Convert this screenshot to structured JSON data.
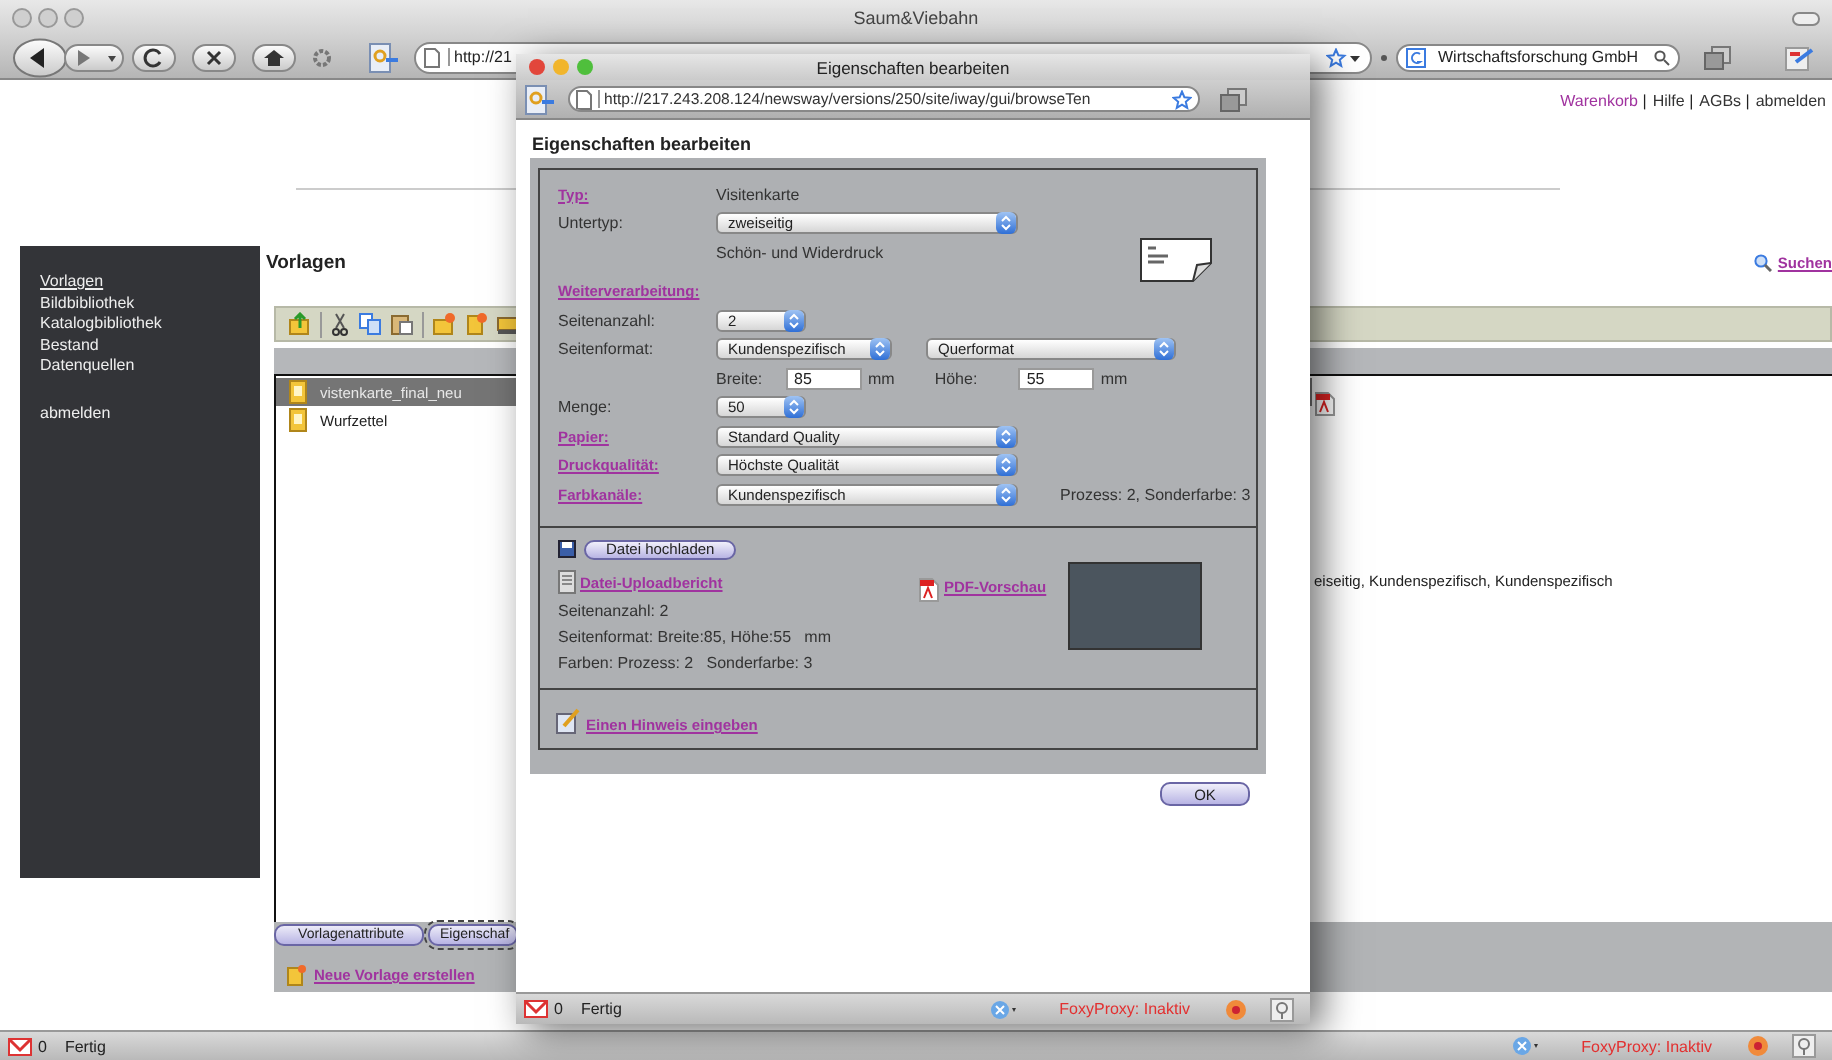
{
  "browser": {
    "title": "Saum&Viebahn",
    "url": "http://21",
    "search": "Wirtschaftsforschung GmbH"
  },
  "header_links": {
    "separator": "|",
    "items": [
      {
        "label": "Warenkorb",
        "visited": true
      },
      {
        "label": "Hilfe",
        "visited": false
      },
      {
        "label": "AGBs",
        "visited": false
      },
      {
        "label": "abmelden",
        "visited": false
      }
    ]
  },
  "sidebar": {
    "items": [
      {
        "label": "Vorlagen",
        "selected": true
      },
      {
        "label": "Bildbibliothek",
        "selected": false
      },
      {
        "label": "Katalogbibliothek",
        "selected": false
      },
      {
        "label": "Bestand",
        "selected": false
      },
      {
        "label": "Datenquellen",
        "selected": false
      }
    ],
    "logout": "abmelden"
  },
  "page": {
    "title": "Vorlagen",
    "search_link": "Suchen"
  },
  "templates": {
    "rows": [
      {
        "name": "vistenkarte_final_neu",
        "selected": true
      },
      {
        "name": "Wurfzettel",
        "selected": false
      }
    ],
    "detail_text": "eiseitig, Kundenspezifisch, Kundenspezifisch"
  },
  "tabs": [
    {
      "label": "Vorlagenattribute",
      "selected": false
    },
    {
      "label": "Eigenschaf",
      "selected": true
    }
  ],
  "new_template_link": "Neue Vorlage erstellen",
  "status_bar": {
    "mail_count": "0",
    "status": "Fertig",
    "proxy": "FoxyProxy: Inaktiv"
  },
  "dialog": {
    "title": "Eigenschaften bearbeiten",
    "url": "http://217.243.208.124/newsway/versions/250/site/iway/gui/browseTen",
    "heading": "Eigenschaften bearbeiten",
    "fields": [
      {
        "kind": "text",
        "label": "Typ:",
        "link": true,
        "value": "Visitenkarte"
      },
      {
        "kind": "select",
        "label": "Untertyp:",
        "link": false,
        "values": [
          "zweiseitig"
        ]
      },
      {
        "kind": "note",
        "text": "Schön- und Widerdruck"
      },
      {
        "kind": "heading",
        "label": "Weiterverarbeitung:",
        "link": true
      },
      {
        "kind": "select",
        "label": "Seitenanzahl:",
        "link": false,
        "values": [
          "2"
        ]
      },
      {
        "kind": "select",
        "label": "Seitenformat:",
        "link": false,
        "values": [
          "Kundenspezifisch",
          "Querformat"
        ]
      },
      {
        "kind": "dimensions",
        "items": [
          {
            "label": "Breite:",
            "value": "85",
            "unit": "mm"
          },
          {
            "label": "Höhe:",
            "value": "55",
            "unit": "mm"
          }
        ]
      },
      {
        "kind": "select",
        "label": "Menge:",
        "link": false,
        "values": [
          "50"
        ]
      },
      {
        "kind": "select",
        "label": "Papier:",
        "link": true,
        "values": [
          "Standard Quality"
        ]
      },
      {
        "kind": "select",
        "label": "Druckqualität:",
        "link": true,
        "values": [
          "Höchste Qualität"
        ]
      },
      {
        "kind": "select",
        "label": "Farbkanäle:",
        "link": true,
        "values": [
          "Kundenspezifisch"
        ],
        "after": "Prozess: 2, Sonderfarbe: 3"
      }
    ],
    "upload": {
      "button": "Datei hochladen",
      "report_link": "Datei-Uploadbericht",
      "report_lines": [
        "Seitenanzahl: 2",
        "Seitenformat: Breite:85, Höhe:55   mm",
        "Farben: Prozess: 2   Sonderfarbe: 3"
      ],
      "pdf_link": "PDF-Vorschau"
    },
    "hint_link": "Einen Hinweis eingeben",
    "ok": "OK",
    "status_bar": {
      "mail_count": "0",
      "status": "Fertig",
      "proxy": "FoxyProxy: Inaktiv"
    }
  }
}
